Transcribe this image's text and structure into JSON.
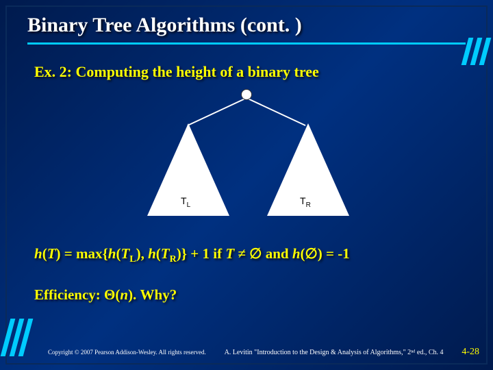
{
  "title": "Binary Tree Algorithms (cont. )",
  "subtitle": "Ex. 2: Computing the height of a binary tree",
  "tree": {
    "left_label": "T",
    "left_sub": "L",
    "right_label": "T",
    "right_sub": "R"
  },
  "formula": {
    "prefix": "h",
    "open": "(",
    "T": "T",
    "close": ")",
    "eq": " = max{",
    "h1": "h",
    "TL": "T",
    "Lsub": "L",
    "mid": "), ",
    "h2": "h",
    "TR": "T",
    "Rsub": "R",
    "rest1": ")} + 1  if ",
    "Tvar": "T",
    "neq": " ≠ ∅   and  ",
    "h3": "h",
    "empty": "(∅) = -1"
  },
  "efficiency": {
    "label": "Efficiency: Θ(",
    "n": "n",
    "rest": ").   Why?"
  },
  "footer": {
    "copyright": "Copyright © 2007 Pearson Addison-Wesley. All rights reserved.",
    "citation": "A. Levitin \"Introduction to the Design & Analysis of Algorithms,\" 2ⁿᵈ ed., Ch. 4",
    "pagenum": "4-28"
  }
}
